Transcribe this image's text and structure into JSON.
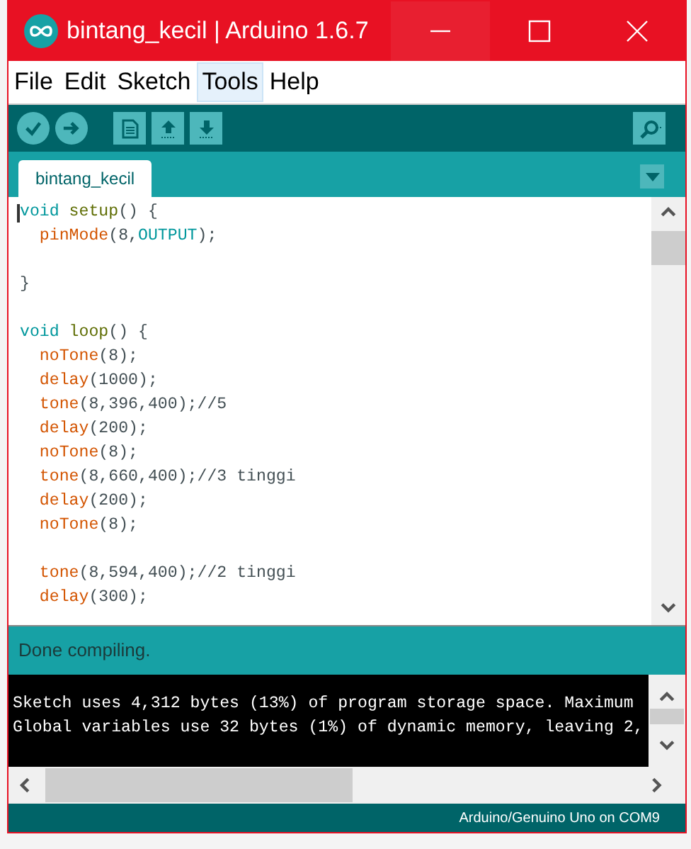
{
  "window": {
    "title": "bintang_kecil | Arduino 1.6.7"
  },
  "menu": [
    {
      "label": "File",
      "selected": false
    },
    {
      "label": "Edit",
      "selected": false
    },
    {
      "label": "Sketch",
      "selected": false
    },
    {
      "label": "Tools",
      "selected": true
    },
    {
      "label": "Help",
      "selected": false
    }
  ],
  "tabs": [
    {
      "label": "bintang_kecil",
      "selected": true
    }
  ],
  "code_blocks": [
    [
      [
        {
          "text": "void ",
          "kind": "type"
        },
        {
          "text": "setup",
          "kind": "func"
        },
        {
          "text": "() {",
          "kind": "plain"
        }
      ],
      [
        {
          "text": "  pinMode",
          "kind": "builtin"
        },
        {
          "text": "(8,",
          "kind": "plain"
        },
        {
          "text": "OUTPUT",
          "kind": "const"
        },
        {
          "text": ");",
          "kind": "plain"
        }
      ]
    ],
    [
      [
        {
          "text": "}",
          "kind": "plain"
        }
      ]
    ],
    [
      [
        {
          "text": "void ",
          "kind": "type"
        },
        {
          "text": "loop",
          "kind": "func"
        },
        {
          "text": "() {",
          "kind": "plain"
        }
      ],
      [
        {
          "text": "  noTone",
          "kind": "builtin"
        },
        {
          "text": "(8);",
          "kind": "plain"
        }
      ],
      [
        {
          "text": "  delay",
          "kind": "builtin"
        },
        {
          "text": "(1000);",
          "kind": "plain"
        }
      ],
      [
        {
          "text": "  tone",
          "kind": "builtin"
        },
        {
          "text": "(8,396,400);//5",
          "kind": "plain"
        }
      ],
      [
        {
          "text": "  delay",
          "kind": "builtin"
        },
        {
          "text": "(200);",
          "kind": "plain"
        }
      ],
      [
        {
          "text": "  noTone",
          "kind": "builtin"
        },
        {
          "text": "(8);",
          "kind": "plain"
        }
      ],
      [
        {
          "text": "  tone",
          "kind": "builtin"
        },
        {
          "text": "(8,660,400);//3 tinggi",
          "kind": "plain"
        }
      ],
      [
        {
          "text": "  delay",
          "kind": "builtin"
        },
        {
          "text": "(200);",
          "kind": "plain"
        }
      ],
      [
        {
          "text": "  noTone",
          "kind": "builtin"
        },
        {
          "text": "(8);",
          "kind": "plain"
        }
      ]
    ],
    [
      [
        {
          "text": "  tone",
          "kind": "builtin"
        },
        {
          "text": "(8,594,400);//2 tinggi",
          "kind": "plain"
        }
      ],
      [
        {
          "text": "  delay",
          "kind": "builtin"
        },
        {
          "text": "(300);",
          "kind": "plain"
        }
      ]
    ]
  ],
  "status": "Done compiling.",
  "console_lines": [
    "Sketch uses 4,312 bytes (13%) of program storage space. Maximum",
    "Global variables use 32 bytes (1%) of dynamic memory, leaving 2,"
  ],
  "board_status": "Arduino/Genuino Uno on COM9"
}
